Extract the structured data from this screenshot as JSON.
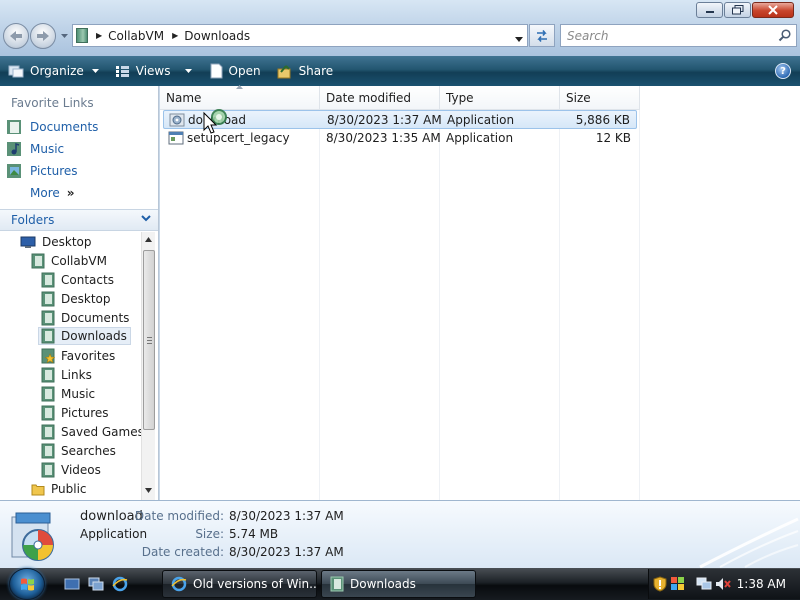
{
  "window": {
    "controls": [
      "minimize",
      "maximize",
      "close"
    ]
  },
  "address_bar": {
    "crumbs": [
      "CollabVM",
      "Downloads"
    ]
  },
  "search": {
    "placeholder": "Search"
  },
  "command_bar": {
    "organize": "Organize",
    "views": "Views",
    "open": "Open",
    "share": "Share",
    "help": "?"
  },
  "nav_pane": {
    "favorites_title": "Favorite Links",
    "favorites": [
      {
        "label": "Documents",
        "icon": "documents-folder-icon"
      },
      {
        "label": "Music",
        "icon": "music-folder-icon"
      },
      {
        "label": "Pictures",
        "icon": "pictures-folder-icon"
      }
    ],
    "more": "More",
    "folders_title": "Folders",
    "tree": [
      {
        "label": "Desktop",
        "level": 0,
        "icon": "desktop-icon"
      },
      {
        "label": "CollabVM",
        "level": 1,
        "icon": "user-folder-icon"
      },
      {
        "label": "Contacts",
        "level": 2,
        "icon": "folder-icon"
      },
      {
        "label": "Desktop",
        "level": 2,
        "icon": "folder-icon"
      },
      {
        "label": "Documents",
        "level": 2,
        "icon": "folder-icon"
      },
      {
        "label": "Downloads",
        "level": 2,
        "icon": "folder-icon",
        "selected": true
      },
      {
        "label": "Favorites",
        "level": 2,
        "icon": "favorites-folder-icon"
      },
      {
        "label": "Links",
        "level": 2,
        "icon": "folder-icon"
      },
      {
        "label": "Music",
        "level": 2,
        "icon": "folder-icon"
      },
      {
        "label": "Pictures",
        "level": 2,
        "icon": "folder-icon"
      },
      {
        "label": "Saved Games",
        "level": 2,
        "icon": "folder-icon"
      },
      {
        "label": "Searches",
        "level": 2,
        "icon": "folder-icon"
      },
      {
        "label": "Videos",
        "level": 2,
        "icon": "folder-icon"
      },
      {
        "label": "Public",
        "level": 1,
        "icon": "yellow-folder-icon"
      }
    ]
  },
  "file_list": {
    "columns": [
      "Name",
      "Date modified",
      "Type",
      "Size"
    ],
    "rows": [
      {
        "name": "download",
        "date": "8/30/2023 1:37 AM",
        "type": "Application",
        "size": "5,886 KB",
        "selected": true
      },
      {
        "name": "setupcert_legacy",
        "date": "8/30/2023 1:35 AM",
        "type": "Application",
        "size": "12 KB",
        "selected": false
      }
    ]
  },
  "details_pane": {
    "name": "download",
    "type": "Application",
    "fields": [
      {
        "label": "Date modified:",
        "value": "8/30/2023 1:37 AM"
      },
      {
        "label": "Size:",
        "value": "5.74 MB"
      },
      {
        "label": "Date created:",
        "value": "8/30/2023 1:37 AM"
      }
    ]
  },
  "taskbar": {
    "buttons": [
      {
        "label": "Old versions of Win...",
        "icon": "ie-icon",
        "active": false
      },
      {
        "label": "Downloads",
        "icon": "explorer-folder-icon",
        "active": true
      }
    ],
    "clock": "1:38 AM"
  },
  "colors": {
    "command_bar": "#1b5270",
    "link_blue": "#1f5fa8",
    "selection": "#d6e7f8"
  }
}
